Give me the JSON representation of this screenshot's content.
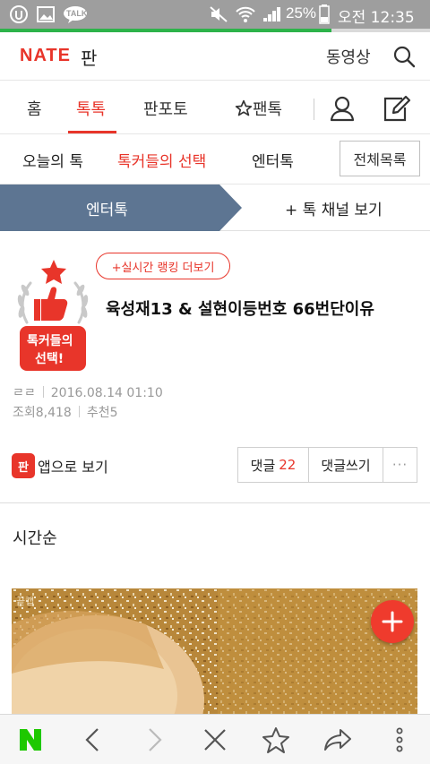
{
  "status_bar": {
    "battery": "25%",
    "time": "오전 12:35",
    "talk_label": "TALK",
    "icons": [
      "u-icon",
      "image-icon",
      "talk-icon",
      "mute-icon",
      "wifi-icon",
      "signal-icon",
      "battery-icon"
    ]
  },
  "header": {
    "logo": "NATE",
    "logo_sub": "판",
    "video": "동영상"
  },
  "main_nav": {
    "items": [
      "홈",
      "톡톡",
      "판포토",
      "팬톡"
    ],
    "active": "톡톡"
  },
  "sub_nav": {
    "items": [
      "오늘의 톡",
      "톡커들의 선택",
      "엔터톡"
    ],
    "active": "톡커들의 선택",
    "all_list": "전체목록"
  },
  "channel_bar": {
    "current": "엔터톡",
    "more": "+ 톡 채널 보기"
  },
  "article": {
    "badge_text_1": "톡커들의",
    "badge_text_2": "선택!",
    "ranking_button": "+실시간 랭킹 더보기",
    "title": "육성재13 & 설현이등번호 66번단이유",
    "author": "ㄹㄹ",
    "date": "2016.08.14 01:10",
    "views": "조회8,418",
    "recommends": "추천5",
    "app_icon_text": "판",
    "app_view": "앱으로 보기",
    "comment_label": "댓글",
    "comment_count": "22",
    "write_comment": "댓글쓰기",
    "more": "···"
  },
  "sort": {
    "label": "시간순"
  },
  "image": {
    "watermark": "끝캡"
  },
  "colors": {
    "accent": "#e8352a",
    "channel_bg": "#5d7592",
    "status_bar": "#9e9e9e",
    "progress": "#2db34a"
  },
  "bottom_bar": {
    "icons": [
      "naver-icon",
      "back-icon",
      "forward-icon",
      "close-icon",
      "bookmark-icon",
      "share-icon",
      "menu-icon"
    ],
    "logo": "N"
  }
}
